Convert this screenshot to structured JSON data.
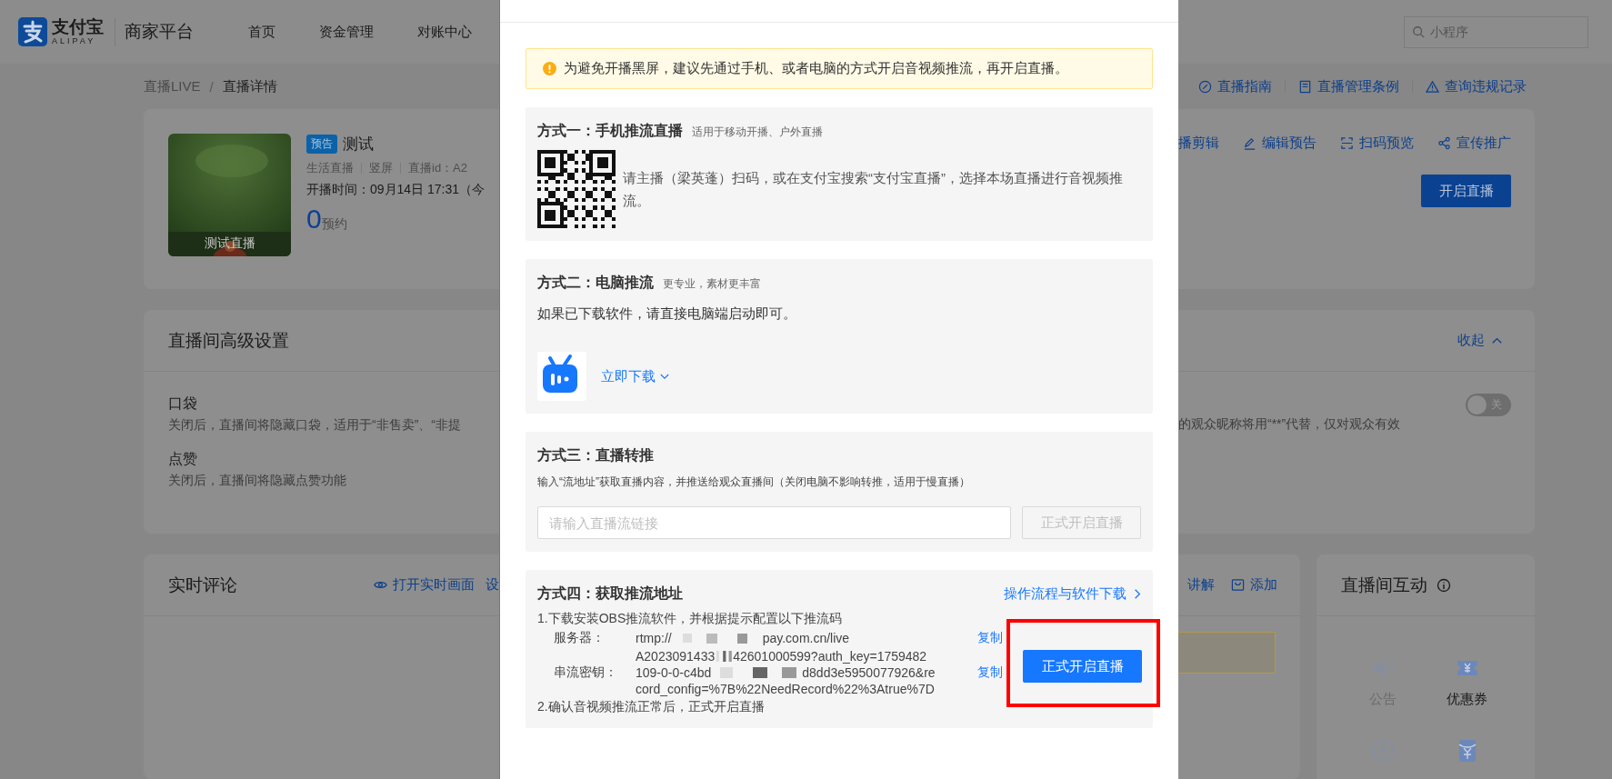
{
  "header": {
    "logo_cn": "支付宝",
    "logo_en": "ALIPAY",
    "platform": "商家平台",
    "nav": [
      {
        "label": "首页"
      },
      {
        "label": "资金管理"
      },
      {
        "label": "对账中心"
      }
    ],
    "search": {
      "placeholder": "小程序"
    }
  },
  "breadcrumb": {
    "parent": "直播LIVE",
    "separator": "/",
    "current": "直播详情"
  },
  "top_links": [
    {
      "label": "直播指南"
    },
    {
      "label": "直播管理条例"
    },
    {
      "label": "查询违规记录"
    }
  ],
  "live_card": {
    "cover_caption": "测试直播",
    "tag": "预告",
    "title": "测试",
    "meta": [
      "生活直播",
      "竖屏",
      "直播id：A2"
    ],
    "start_time": "开播时间：09月14日 17:31（今",
    "reserve_count": "0",
    "reserve_label": "预约",
    "actions": [
      {
        "label": "播剪辑"
      },
      {
        "label": "编辑预告"
      },
      {
        "label": "扫码预览"
      },
      {
        "label": "宣传推广"
      }
    ],
    "start_button": "开启直播"
  },
  "settings": {
    "title": "直播间高级设置",
    "collapse": "收起",
    "left_items": [
      {
        "name": "口袋",
        "desc": "关闭后，直播间将隐藏口袋，适用于“非售卖”、“非提"
      },
      {
        "name": "点赞",
        "desc": "关闭后，直播间将隐藏点赞功能"
      }
    ],
    "right_item": {
      "desc": "的观众昵称将用“**”代替，仅对观众有效",
      "toggle": {
        "on": false,
        "label": "关"
      }
    }
  },
  "comments": {
    "title": "实时评论",
    "left_links": [
      {
        "label": "打开实时画面"
      },
      {
        "label": "设"
      }
    ],
    "right_links": [
      {
        "label": "讲解"
      },
      {
        "label": "添加"
      }
    ]
  },
  "interaction": {
    "title": "直播间互动",
    "tools": [
      {
        "label": "公告",
        "disabled": true
      },
      {
        "label": "优惠券",
        "disabled": false
      },
      {
        "disabled": true
      },
      {
        "disabled": false
      }
    ]
  },
  "modal": {
    "alert": "为避免开播黑屏，建议先通过手机、或者电脑的方式开启音视频推流，再开启直播。",
    "methods": [
      {
        "kind": "mobile",
        "title": "方式一：手机推流直播",
        "subtitle": "适用于移动开播、户外直播",
        "text": "请主播（梁英蓬）扫码，或在支付宝搜索“支付宝直播”，选择本场直播进行音视频推流。"
      },
      {
        "kind": "pc",
        "title": "方式二：电脑推流",
        "subtitle": "更专业，素材更丰富",
        "text": "如果已下载软件，请直接电脑端启动即可。",
        "download": "立即下载"
      },
      {
        "kind": "relay",
        "title": "方式三：直播转推",
        "text": "输入“流地址”获取直播内容，并推送给观众直播间（关闭电脑不影响转推，适用于慢直播）",
        "input": {
          "placeholder": "请输入直播流链接"
        },
        "button": {
          "label": "正式开启直播",
          "disabled": true
        }
      },
      {
        "kind": "obs",
        "title": "方式四：获取推流地址",
        "link": "操作流程与软件下载",
        "step1": "1.下载安装OBS推流软件，并根据提示配置以下推流码",
        "server": {
          "label": "服务器：",
          "parts": [
            "rtmp://",
            "pay.com.cn/live"
          ],
          "copy": "复制"
        },
        "key": {
          "label": "串流密钥：",
          "lines": [
            {
              "parts": [
                "A2023091433",
                "42601000599?auth_key=1759482"
              ]
            },
            {
              "parts": [
                "109-0-0-c4bd",
                "d8dd3e5950077926&re"
              ]
            },
            {
              "parts": [
                "cord_config=%7B%22NeedRecord%22%3Atrue%7D"
              ]
            }
          ],
          "copy": "复制"
        },
        "step2": "2.确认音视频推流正常后，正式开启直播",
        "button": {
          "label": "正式开启直播",
          "disabled": false
        },
        "highlighted": true
      }
    ]
  }
}
